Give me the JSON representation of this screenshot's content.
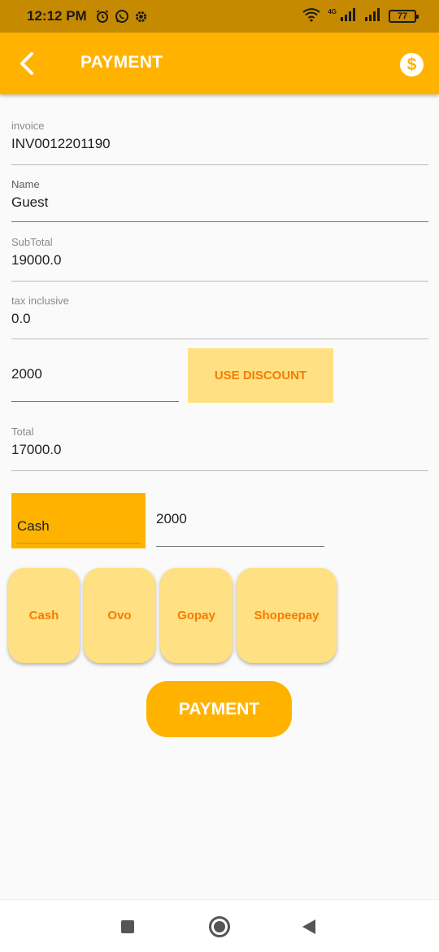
{
  "status_bar": {
    "time": "12:12 PM",
    "network_label": "4G",
    "battery": "77",
    "icons": [
      "alarm-icon",
      "whatsapp-icon",
      "settings-icon",
      "wifi-icon",
      "signal-icon",
      "signal-icon",
      "battery-icon"
    ]
  },
  "app_bar": {
    "title": "PAYMENT",
    "back_icon": "chevron-left-icon",
    "action_icon": "dollar-coin-icon",
    "action_symbol": "$"
  },
  "form": {
    "invoice": {
      "label": "invoice",
      "value": "INV0012201190"
    },
    "name": {
      "label": "Name",
      "value": "Guest"
    },
    "subtotal": {
      "label": "SubTotal",
      "value": "19000.0"
    },
    "tax": {
      "label": "tax inclusive",
      "value": "0.0"
    },
    "discount": {
      "value": "2000",
      "button_label": "USE DISCOUNT"
    },
    "total": {
      "label": "Total",
      "value": "17000.0"
    },
    "payment_method": {
      "selected": "Cash"
    },
    "amount": {
      "value": "2000"
    }
  },
  "payment_options": [
    {
      "label": "Cash"
    },
    {
      "label": "Ovo"
    },
    {
      "label": "Gopay"
    },
    {
      "label": "Shopeepay"
    }
  ],
  "submit": {
    "label": "PAYMENT"
  },
  "colors": {
    "primary": "#ffb300",
    "status_bar": "#c58a00",
    "option_background": "#ffe082",
    "option_text": "#f57c00",
    "background": "#fafafa"
  }
}
